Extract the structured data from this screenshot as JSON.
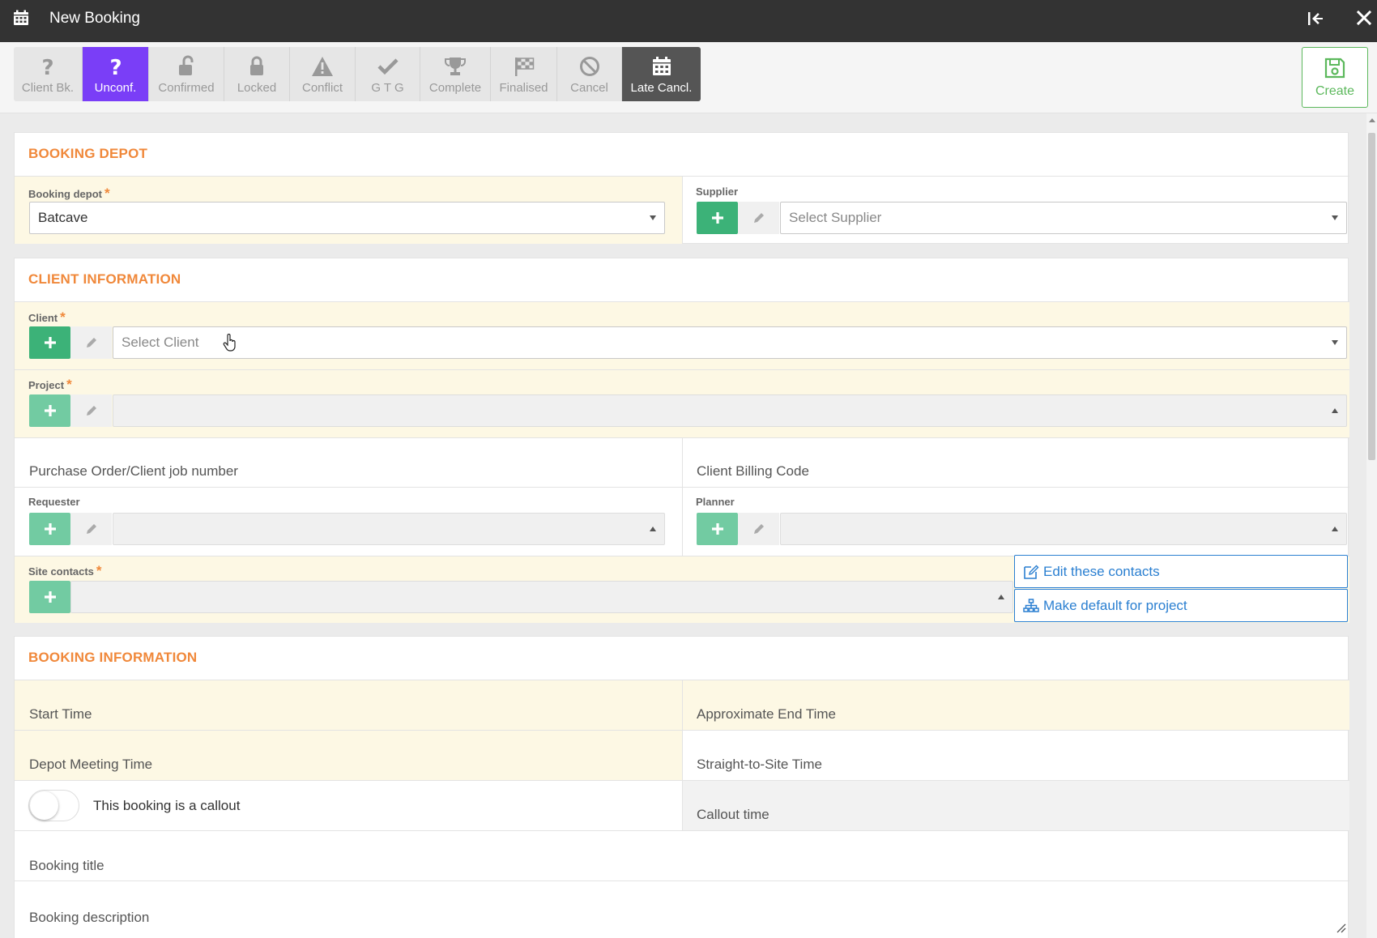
{
  "window": {
    "title": "New Booking"
  },
  "status_buttons": [
    {
      "label": "Client Bk.",
      "icon": "question-icon",
      "state": "default"
    },
    {
      "label": "Unconf.",
      "icon": "question-icon",
      "state": "active"
    },
    {
      "label": "Confirmed",
      "icon": "unlock-icon",
      "state": "default"
    },
    {
      "label": "Locked",
      "icon": "lock-icon",
      "state": "default"
    },
    {
      "label": "Conflict",
      "icon": "warning-icon",
      "state": "default"
    },
    {
      "label": "G T G",
      "icon": "check-icon",
      "state": "default"
    },
    {
      "label": "Complete",
      "icon": "trophy-icon",
      "state": "default"
    },
    {
      "label": "Finalised",
      "icon": "checkered-flag-icon",
      "state": "default"
    },
    {
      "label": "Cancel",
      "icon": "ban-icon",
      "state": "default"
    },
    {
      "label": "Late Cancl.",
      "icon": "calendar-icon",
      "state": "dark"
    }
  ],
  "create": {
    "label": "Create",
    "icon": "save-icon"
  },
  "booking_depot": {
    "heading": "BOOKING DEPOT",
    "depot_label": "Booking depot",
    "depot_value": "Batcave",
    "supplier_label": "Supplier",
    "supplier_placeholder": "Select Supplier"
  },
  "client_info": {
    "heading": "CLIENT INFORMATION",
    "client_label": "Client",
    "client_placeholder": "Select Client",
    "project_label": "Project",
    "po_label": "Purchase Order/Client job number",
    "billing_label": "Client Billing Code",
    "requester_label": "Requester",
    "planner_label": "Planner",
    "site_contacts_label": "Site contacts",
    "edit_contacts_label": "Edit these contacts",
    "make_default_label": "Make default for project"
  },
  "booking_info": {
    "heading": "BOOKING INFORMATION",
    "start_time_label": "Start Time",
    "end_time_label": "Approximate End Time",
    "depot_meeting_label": "Depot Meeting Time",
    "straight_to_site_label": "Straight-to-Site Time",
    "callout_toggle_label": "This booking is a callout",
    "callout_time_label": "Callout time",
    "title_label": "Booking title",
    "description_label": "Booking description"
  },
  "colors": {
    "titlebar": "#333333",
    "active_status": "#7a3ef7",
    "dark_status": "#555555",
    "heading_orange": "#f0883a",
    "add_green": "#3cb278",
    "create_green": "#5cb85c",
    "link_blue": "#2a7fd1",
    "required_bg": "#fdf8e4"
  }
}
